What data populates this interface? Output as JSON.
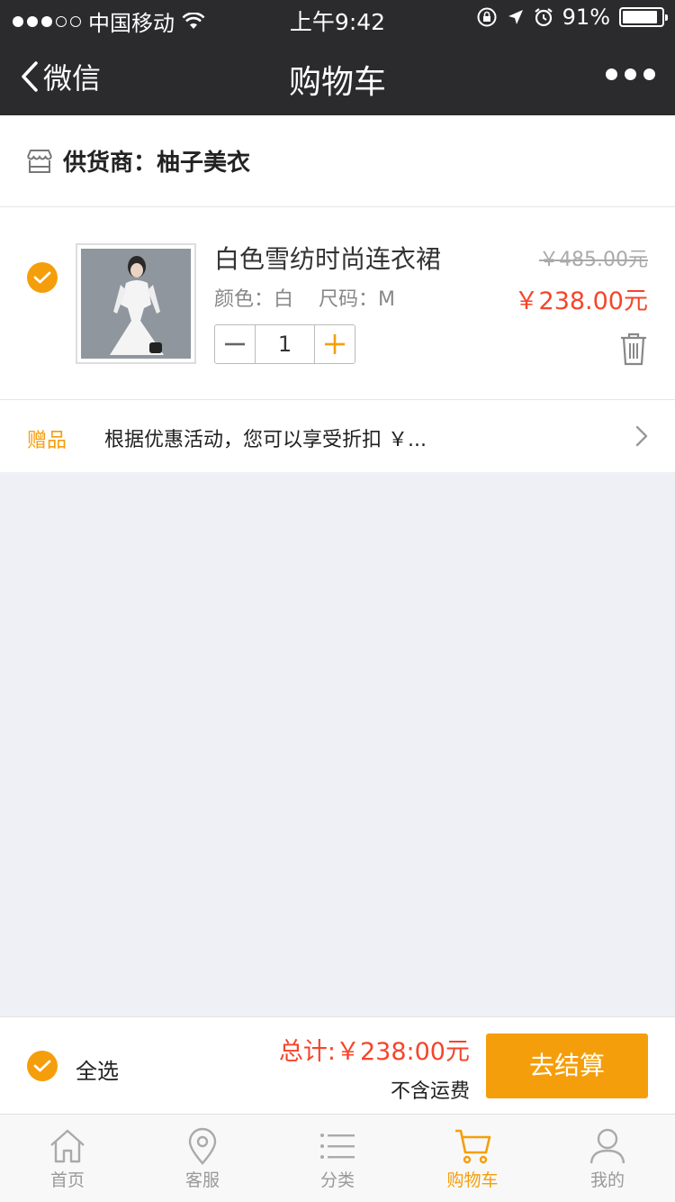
{
  "status_bar": {
    "carrier": "中国移动",
    "time": "上午9:42",
    "battery": "91%",
    "battery_level": 0.91
  },
  "nav": {
    "back_label": "微信",
    "title": "购物车"
  },
  "supplier": {
    "label": "供货商：柚子美衣"
  },
  "item": {
    "name": "白色雪纺时尚连衣裙",
    "color": "颜色：白",
    "size": "尺码：M",
    "quantity": "1",
    "original_price": "￥485.00元",
    "price": "￥238.00元"
  },
  "gift": {
    "tag": "赠品",
    "description": "根据优惠活动，您可以享受折扣 ￥..."
  },
  "footer": {
    "select_all": "全选",
    "total": "总计:￥238:00元",
    "shipping_note": "不含运费",
    "checkout": "去结算"
  },
  "tabs": [
    {
      "label": "首页",
      "icon": "home-icon"
    },
    {
      "label": "客服",
      "icon": "location-pin-icon"
    },
    {
      "label": "分类",
      "icon": "list-icon"
    },
    {
      "label": "购物车",
      "icon": "cart-icon"
    },
    {
      "label": "我的",
      "icon": "user-icon"
    }
  ],
  "colors": {
    "accent": "#f59e0b",
    "price": "#f5452a",
    "nav_bg": "#2b2b2d",
    "page_bg": "#efeff6"
  }
}
